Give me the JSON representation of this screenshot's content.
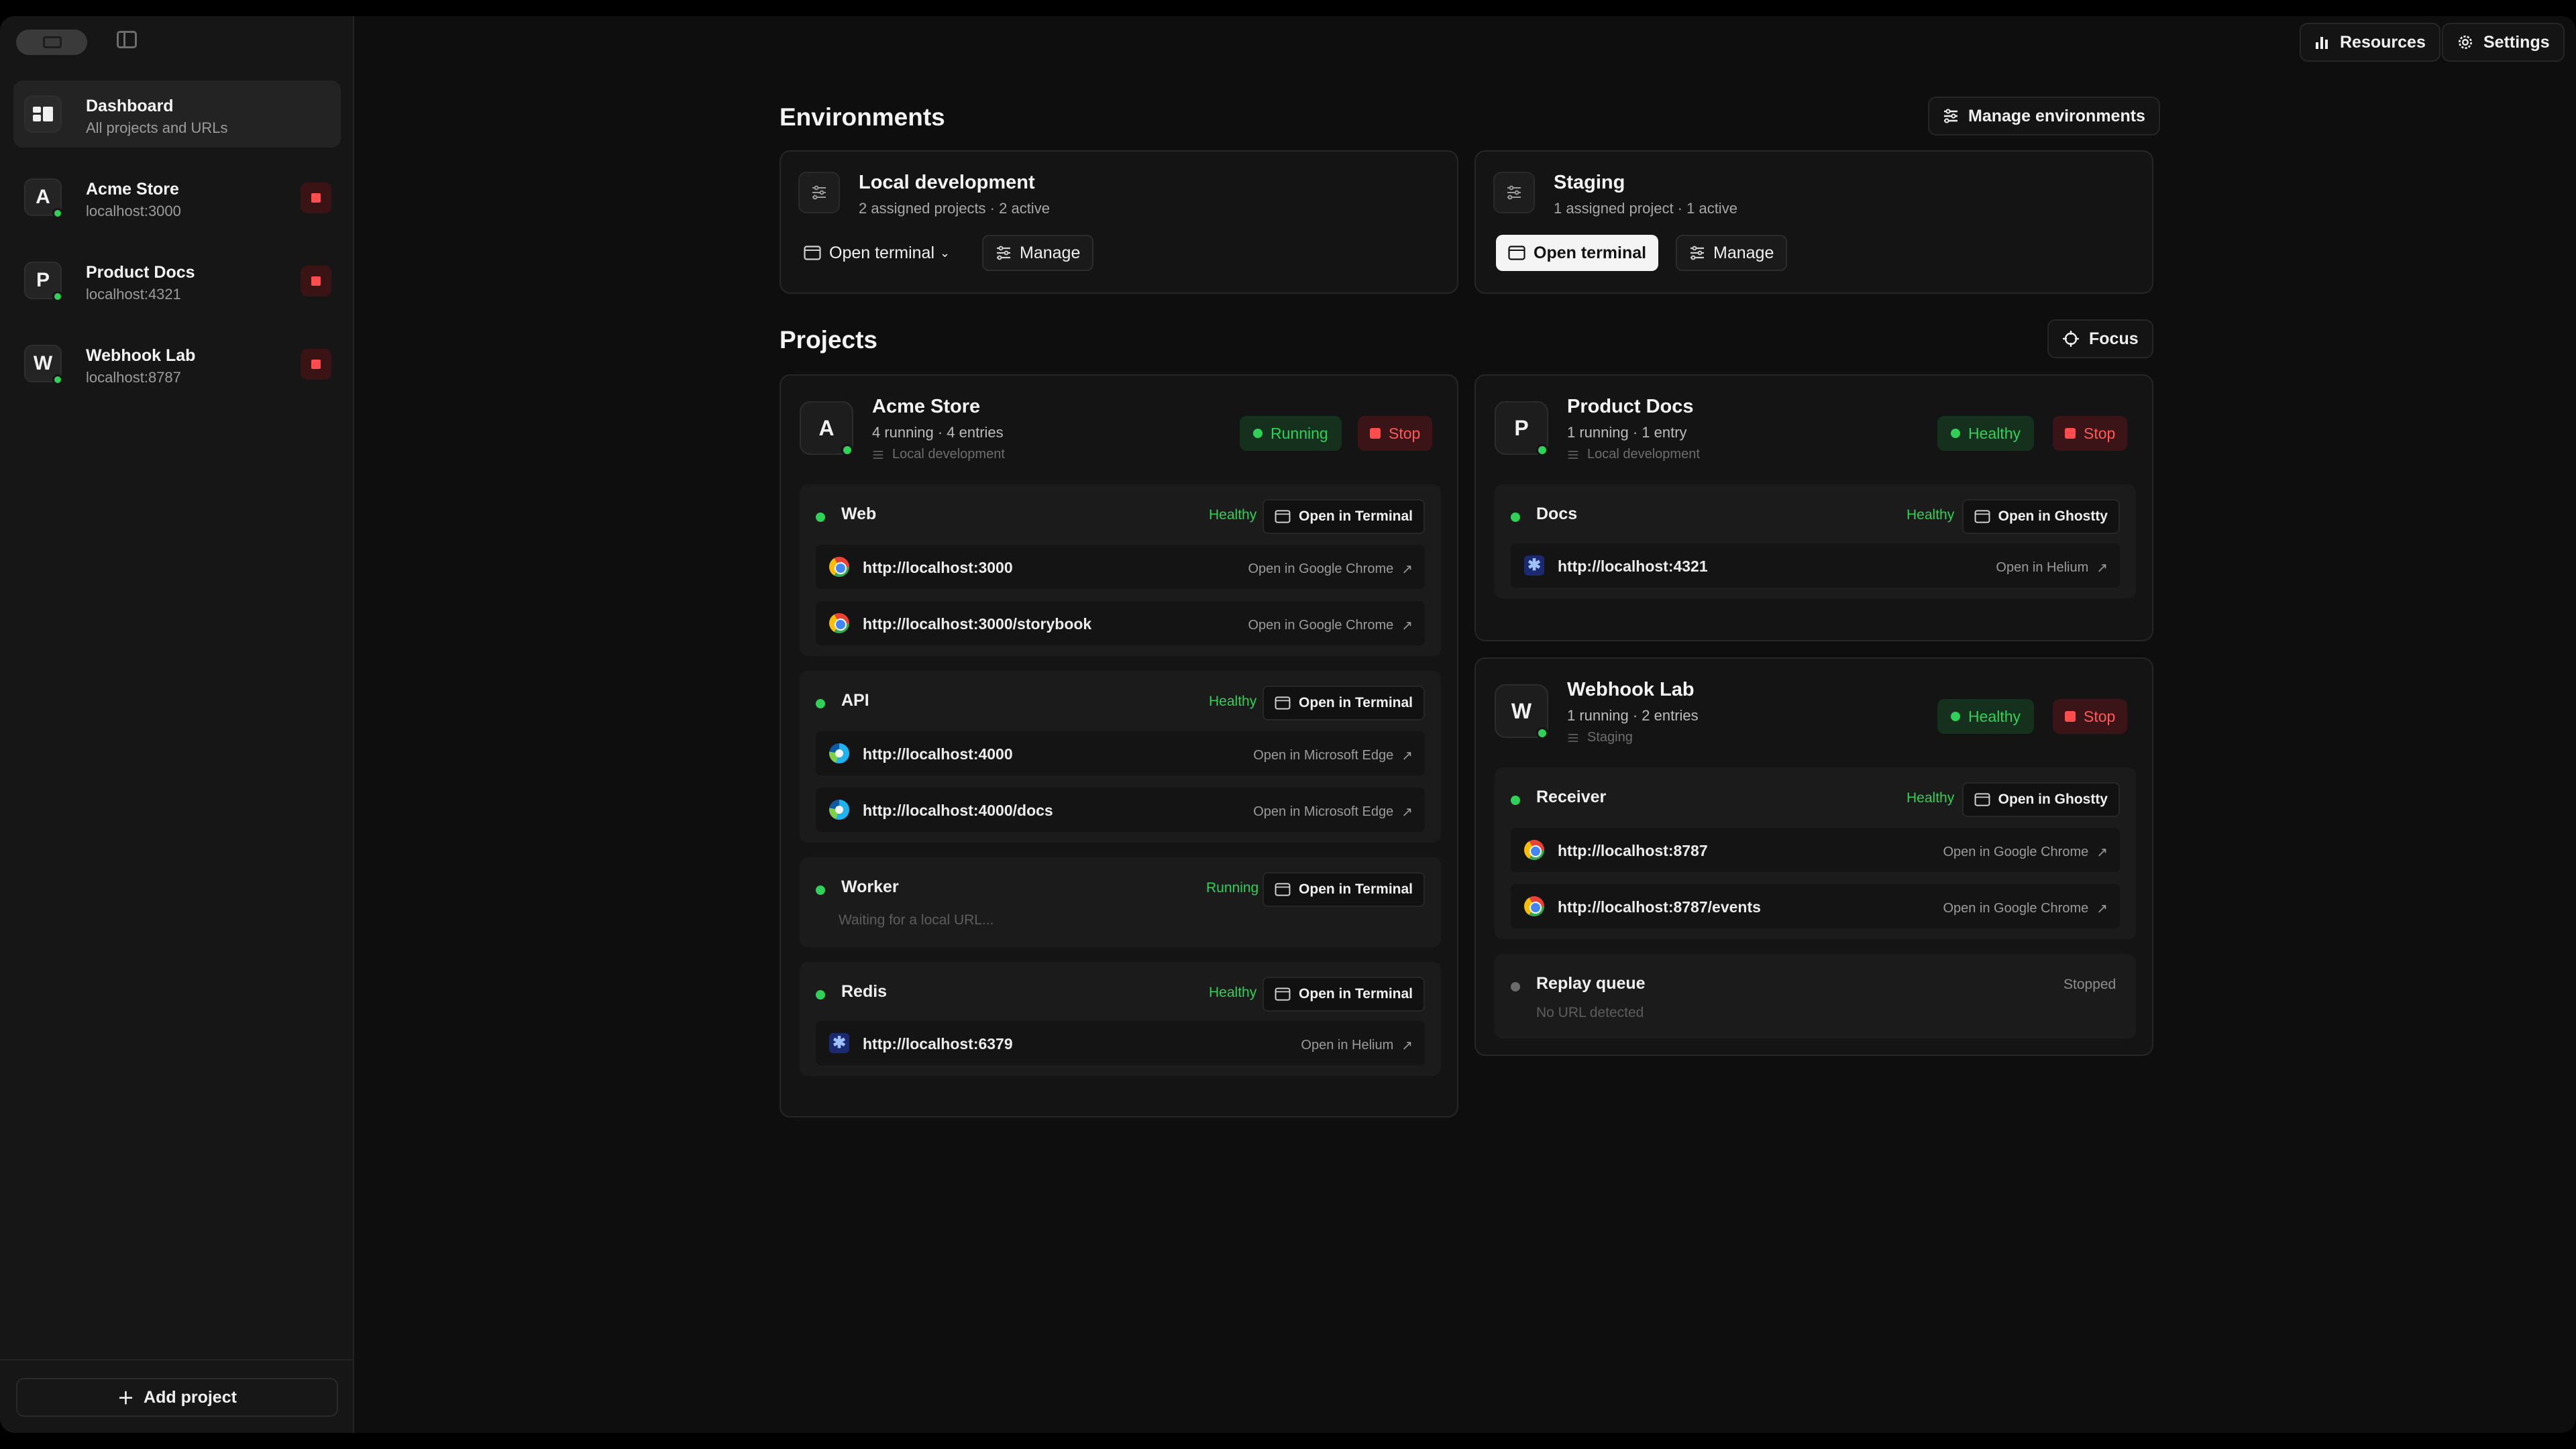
{
  "sidebar": {
    "items": [
      {
        "title": "Dashboard",
        "subtitle": "All projects and URLs"
      },
      {
        "letter": "A",
        "title": "Acme Store",
        "subtitle": "localhost:3000"
      },
      {
        "letter": "P",
        "title": "Product Docs",
        "subtitle": "localhost:4321"
      },
      {
        "letter": "W",
        "title": "Webhook Lab",
        "subtitle": "localhost:8787"
      }
    ],
    "add_project_label": "Add project"
  },
  "topbar": {
    "resources_label": "Resources",
    "settings_label": "Settings"
  },
  "environments": {
    "title": "Environments",
    "manage_label": "Manage environments",
    "cards": [
      {
        "title": "Local development",
        "subtitle": "2 assigned projects · 2 active",
        "open_label": "Open terminal",
        "manage_label": "Manage"
      },
      {
        "title": "Staging",
        "subtitle": "1 assigned project · 1 active",
        "open_label": "Open terminal",
        "manage_label": "Manage"
      }
    ]
  },
  "projects": {
    "title": "Projects",
    "focus_label": "Focus",
    "acme": {
      "letter": "A",
      "title": "Acme Store",
      "subtitle": "4 running · 4 entries",
      "env": "Local development",
      "badge": "Running",
      "stop": "Stop",
      "services": [
        {
          "name": "Web",
          "status": "Healthy",
          "open": "Open in Terminal",
          "urls": [
            {
              "url": "http://localhost:3000",
              "open": "Open in Google Chrome",
              "icon": "chrome-icon"
            },
            {
              "url": "http://localhost:3000/storybook",
              "open": "Open in Google Chrome",
              "icon": "chrome-icon"
            }
          ]
        },
        {
          "name": "API",
          "status": "Healthy",
          "open": "Open in Terminal",
          "urls": [
            {
              "url": "http://localhost:4000",
              "open": "Open in Microsoft Edge",
              "icon": "edge-icon"
            },
            {
              "url": "http://localhost:4000/docs",
              "open": "Open in Microsoft Edge",
              "icon": "edge-icon"
            }
          ]
        },
        {
          "name": "Worker",
          "status": "Running",
          "open": "Open in Terminal",
          "note": "Waiting for a local URL..."
        },
        {
          "name": "Redis",
          "status": "Healthy",
          "open": "Open in Terminal",
          "urls": [
            {
              "url": "http://localhost:6379",
              "open": "Open in Helium",
              "icon": "helium-icon"
            }
          ]
        }
      ]
    },
    "docs": {
      "letter": "P",
      "title": "Product Docs",
      "subtitle": "1 running · 1 entry",
      "env": "Local development",
      "badge": "Healthy",
      "stop": "Stop",
      "services": [
        {
          "name": "Docs",
          "status": "Healthy",
          "open": "Open in Ghostty",
          "urls": [
            {
              "url": "http://localhost:4321",
              "open": "Open in Helium",
              "icon": "helium-icon"
            }
          ]
        }
      ]
    },
    "webhook": {
      "letter": "W",
      "title": "Webhook Lab",
      "subtitle": "1 running · 2 entries",
      "env": "Staging",
      "badge": "Healthy",
      "stop": "Stop",
      "services": [
        {
          "name": "Receiver",
          "status": "Healthy",
          "open": "Open in Ghostty",
          "urls": [
            {
              "url": "http://localhost:8787",
              "open": "Open in Google Chrome",
              "icon": "chrome-icon"
            },
            {
              "url": "http://localhost:8787/events",
              "open": "Open in Google Chrome",
              "icon": "chrome-icon"
            }
          ]
        },
        {
          "name": "Replay queue",
          "status": "Stopped",
          "note": "No URL detected"
        }
      ]
    }
  },
  "colors": {
    "accent_green": "#30d158",
    "stop_red": "#ff4d4d",
    "background": "#0e0e0e"
  }
}
